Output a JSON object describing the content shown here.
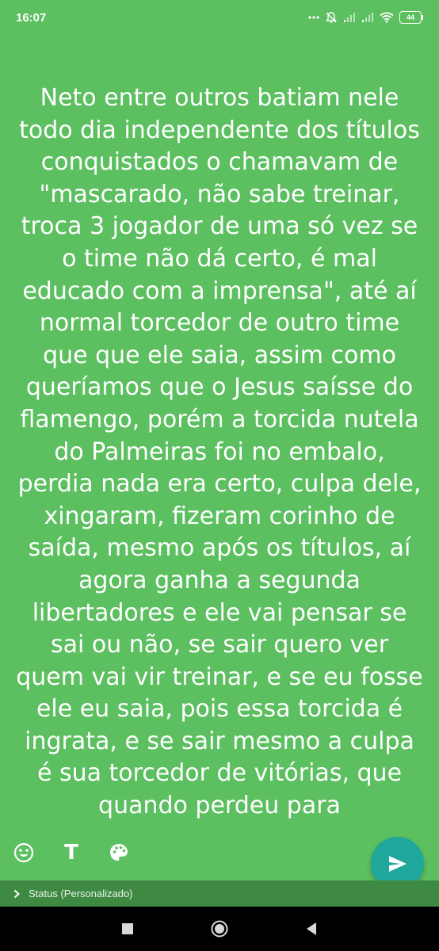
{
  "status_bar": {
    "time": "16:07",
    "battery_level": "44",
    "icons": [
      "dots-icon",
      "alarm-off-icon",
      "signal-icon",
      "signal-icon",
      "wifi-icon",
      "battery-icon"
    ]
  },
  "status_text": "Neto entre outros batiam nele\ntodo dia independente dos títulos\nconquistados o chamavam de\n\"mascarado, não sabe treinar,\ntroca 3 jogador de uma só vez se\no time não dá certo, é mal\neducado com a imprensa\", até aí\nnormal torcedor de outro time\nque que ele saia, assim como\nqueríamos que o Jesus saísse do\nflamengo, porém a torcida nutela\ndo Palmeiras foi no embalo,\nperdia nada era certo, culpa dele,\nxingaram, fizeram corinho de\nsaída, mesmo após os títulos, aí\nagora ganha a segunda\nlibertadores e ele vai pensar se\nsai ou não, se sair quero ver\nquem vai vir treinar, e se eu fosse\nele eu saia, pois essa torcida é\ningrata, e se sair mesmo a culpa\né sua torcedor de vitórias, que\nquando perdeu para",
  "toolbar": {
    "text_tool_label": "T",
    "icons": [
      "emoji-icon",
      "text-style-icon",
      "palette-icon"
    ]
  },
  "send_button": {
    "icon": "send-icon",
    "color": "#1ea79a"
  },
  "audience": {
    "label": "Status (Personalizado)",
    "icon": "chevron-right-icon"
  },
  "nav": {
    "icons": [
      "recents-square-icon",
      "home-circle-icon",
      "back-triangle-icon"
    ]
  },
  "colors": {
    "background": "#5cbf60",
    "audience_bar": "#3f8a43",
    "send_button": "#1ea79a"
  }
}
